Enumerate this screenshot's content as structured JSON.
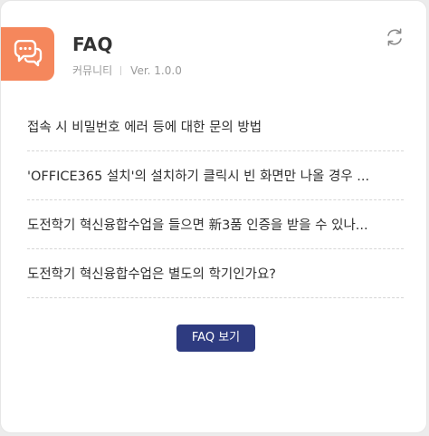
{
  "widget": {
    "title": "FAQ",
    "category": "커뮤니티",
    "version": "Ver. 1.0.0",
    "icon": "chat-bubbles-icon",
    "refresh_icon": "refresh-icon",
    "accent_color": "#f5875c"
  },
  "faq": {
    "items": [
      "접속 시 비밀번호 에러 등에 대한 문의 방법",
      "'OFFICE365 설치'의 설치하기 클릭시 빈 화면만 나올 경우 ...",
      "도전학기 혁신융합수업을 들으면 新3품 인증을 받을 수 있나...",
      "도전학기 혁신융합수업은 별도의 학기인가요?"
    ],
    "button_label": "FAQ 보기",
    "button_color": "#2e3b80"
  }
}
